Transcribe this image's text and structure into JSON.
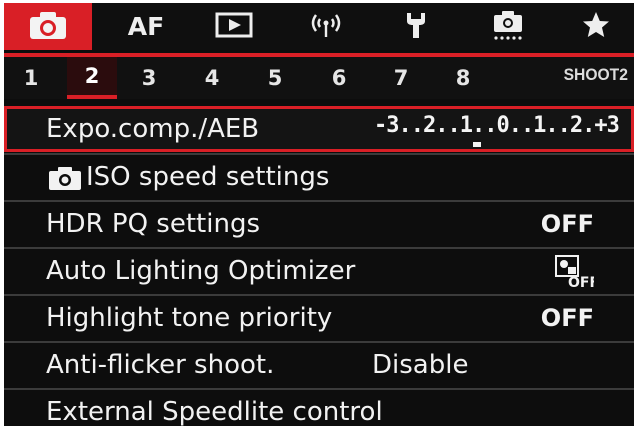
{
  "categories": [
    {
      "name": "camera-tab",
      "icon": "camera-icon",
      "label": ""
    },
    {
      "name": "af-tab",
      "icon": "",
      "label": "AF"
    },
    {
      "name": "playback-tab",
      "icon": "play-icon",
      "label": ""
    },
    {
      "name": "wireless-tab",
      "icon": "wireless-icon",
      "label": ""
    },
    {
      "name": "setup-tab",
      "icon": "wrench-icon",
      "label": ""
    },
    {
      "name": "custom-tab",
      "icon": "custom-camera-icon",
      "label": ""
    },
    {
      "name": "mymenu-tab",
      "icon": "star-icon",
      "label": ""
    }
  ],
  "pages": {
    "numbers": [
      "1",
      "2",
      "3",
      "4",
      "5",
      "6",
      "7",
      "8"
    ],
    "active": "2",
    "label": "SHOOT2"
  },
  "menu": {
    "expo": {
      "label": "Expo.comp./AEB",
      "scale": "-3..2..1..0..1..2.+3"
    },
    "iso": {
      "label": "ISO speed settings"
    },
    "hdr": {
      "label": "HDR PQ settings",
      "value": "OFF"
    },
    "alo": {
      "label": "Auto Lighting Optimizer",
      "value_icon": "alo-off-icon",
      "value": "OFF"
    },
    "htp": {
      "label": "Highlight tone priority",
      "value": "OFF"
    },
    "flicker": {
      "label": "Anti-flicker shoot.",
      "value": "Disable"
    },
    "speedlite": {
      "label": "External Speedlite control"
    }
  },
  "colors": {
    "accent": "#d91f26",
    "background": "#0d0d0d",
    "text": "#f2f2f2"
  }
}
